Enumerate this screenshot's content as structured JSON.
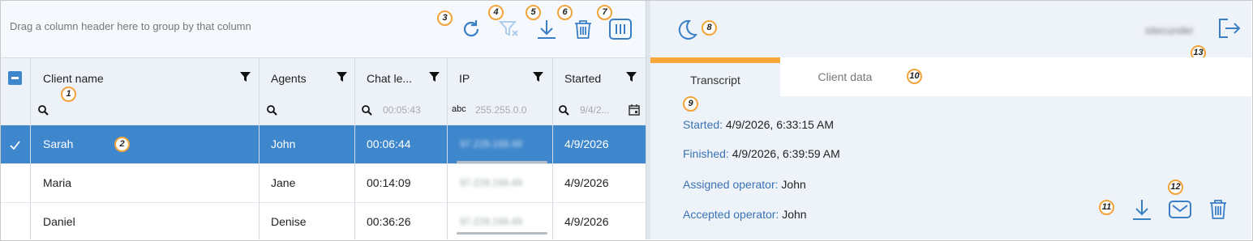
{
  "toolbar": {
    "group_hint": "Drag a column header here to group by that column",
    "icons": [
      "refresh-icon",
      "clear-filter-icon",
      "download-icon",
      "delete-icon",
      "columns-icon"
    ]
  },
  "badges": [
    "1",
    "2",
    "3",
    "4",
    "5",
    "6",
    "7",
    "8",
    "9",
    "10",
    "11",
    "12",
    "13"
  ],
  "grid": {
    "columns": [
      {
        "title": "Client name",
        "filter_placeholder": ""
      },
      {
        "title": "Agents",
        "filter_placeholder": ""
      },
      {
        "title": "Chat le...",
        "filter_placeholder": "00:05:43"
      },
      {
        "title": "IP",
        "filter_placeholder": "255.255.0.0"
      },
      {
        "title": "Started",
        "filter_placeholder": "9/4/2..."
      }
    ],
    "rows": [
      {
        "client": "Sarah",
        "agent": "John",
        "length": "00:06:44",
        "ip": "97.229.168.49",
        "started": "4/9/2026",
        "selected": true
      },
      {
        "client": "Maria",
        "agent": "Jane",
        "length": "00:14:09",
        "ip": "97.229.168.49",
        "started": "4/9/2026",
        "selected": false
      },
      {
        "client": "Daniel",
        "agent": "Denise",
        "length": "00:36:26",
        "ip": "97.229.168.49",
        "started": "4/9/2026",
        "selected": false
      }
    ],
    "ip_filter_prefix": "abc"
  },
  "detail": {
    "username": "sitecunder",
    "tabs": [
      {
        "label": "Transcript",
        "active": true
      },
      {
        "label": "Client data",
        "active": false
      }
    ],
    "info": [
      {
        "label": "Started:",
        "value": "4/9/2026, 6:33:15 AM"
      },
      {
        "label": "Finished:",
        "value": "4/9/2026, 6:39:59 AM"
      },
      {
        "label": "Assigned operator:",
        "value": "John"
      },
      {
        "label": "Accepted operator:",
        "value": "John"
      }
    ]
  },
  "colors": {
    "accent": "#3f87cc",
    "icon_blue": "#3a7fc6",
    "badge_orange": "#f2a33a",
    "tab_orange": "#f5a738",
    "panel_bg": "#eef3f9"
  }
}
